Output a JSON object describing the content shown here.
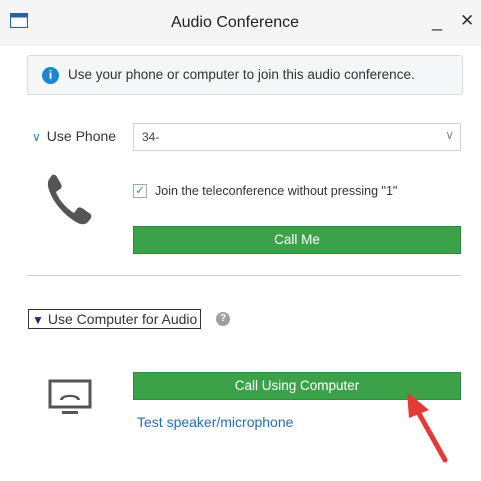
{
  "window": {
    "title": "Audio Conference",
    "minimize_glyph": "_",
    "close_glyph": "✕"
  },
  "info": {
    "icon": "i",
    "text": "Use your phone or computer to join this audio conference."
  },
  "phone": {
    "toggle_label": "Use Phone",
    "number_value": "34-",
    "join_checked": true,
    "join_label": "Join the teleconference without pressing \"1\"",
    "call_me_label": "Call Me"
  },
  "computer": {
    "toggle_label": "Use Computer for Audio",
    "help_icon": "?",
    "call_button_label": "Call Using Computer",
    "test_link_label": "Test speaker/microphone"
  },
  "colors": {
    "accent_blue": "#1c86d4",
    "button_green": "#3ca24a",
    "link_blue": "#1c6dc4",
    "annotation_red": "#e53935"
  }
}
